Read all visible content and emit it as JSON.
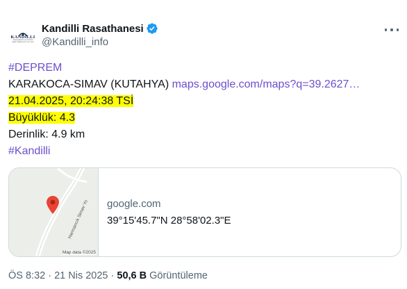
{
  "account": {
    "display_name": "Kandilli Rasathanesi",
    "handle": "@Kandilli_info",
    "avatar_text": "KANDILLI",
    "avatar_subtext": "RASATHANESİ VE DEPREM ARAŞTIRMA ENSTİTÜSÜ 1868"
  },
  "tweet": {
    "hashtag1": "#DEPREM",
    "location": "KARAKOCA-SIMAV (KUTAHYA)",
    "map_link": "maps.google.com/maps?q=39.2627…",
    "datetime": "21.04.2025, 20:24:38 TSİ",
    "magnitude": "Büyüklük: 4.3",
    "depth": "Derinlik: 4.9 km",
    "hashtag2": "#Kandilli"
  },
  "card": {
    "domain": "google.com",
    "coordinates": "39°15'45.7\"N 28°58'02.3\"E",
    "map_road_label": "Harmancık Simav Yo",
    "map_credit": "Map data ©2025"
  },
  "meta": {
    "time": "ÖS 8:32",
    "separator1": " · ",
    "date": "21 Nis 2025",
    "separator2": " · ",
    "views": "50,6 B",
    "views_label": " Görüntüleme"
  },
  "colors": {
    "link": "#6b4fcc",
    "highlight": "#ffff00",
    "verified": "#1d9bf0",
    "pin": "#ea4335"
  },
  "icons": [
    "verified-badge-icon",
    "more-options-icon",
    "map-pin-icon"
  ]
}
